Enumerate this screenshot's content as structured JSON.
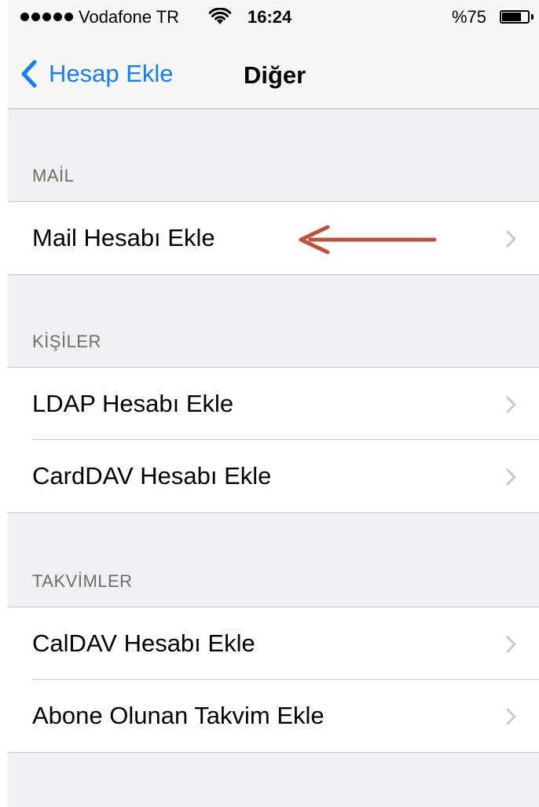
{
  "status_bar": {
    "carrier": "Vodafone TR",
    "time": "16:24",
    "battery_percent_text": "%75",
    "battery_level": 0.75,
    "signal_dots": 5
  },
  "nav": {
    "back_label": "Hesap Ekle",
    "title": "Diğer"
  },
  "sections": [
    {
      "header": "MAİL",
      "items": [
        {
          "label": "Mail Hesabı Ekle"
        }
      ]
    },
    {
      "header": "KİŞİLER",
      "items": [
        {
          "label": "LDAP Hesabı Ekle"
        },
        {
          "label": "CardDAV Hesabı Ekle"
        }
      ]
    },
    {
      "header": "TAKVİMLER",
      "items": [
        {
          "label": "CalDAV Hesabı Ekle"
        },
        {
          "label": "Abone Olunan Takvim Ekle"
        }
      ]
    }
  ],
  "annotation": {
    "arrow_color": "#c0503a"
  },
  "colors": {
    "ios_blue": "#157efb",
    "grouped_background": "#efeff4",
    "separator": "#c8c7cc",
    "chevron": "#c7c7cc"
  }
}
